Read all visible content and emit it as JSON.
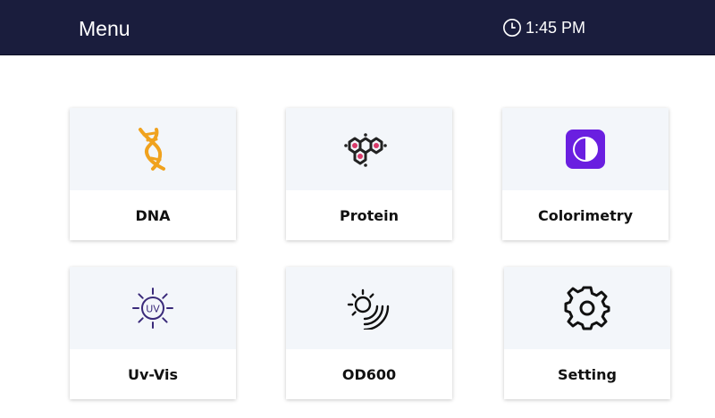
{
  "header": {
    "title": "Menu",
    "time": "1:45 PM",
    "clock_icon": "clock-icon"
  },
  "tiles": [
    {
      "label": "DNA",
      "icon": "dna-icon",
      "icon_color": "#f0a21e"
    },
    {
      "label": "Protein",
      "icon": "protein-icon",
      "icon_color": "#d93a6a"
    },
    {
      "label": "Colorimetry",
      "icon": "colorimetry-icon",
      "icon_color": "#6a1fe0"
    },
    {
      "label": "Uv-Vis",
      "icon": "uv-icon",
      "icon_color": "#3a2a7a"
    },
    {
      "label": "OD600",
      "icon": "od600-icon",
      "icon_color": "#111111"
    },
    {
      "label": "Setting",
      "icon": "gear-icon",
      "icon_color": "#111111"
    }
  ],
  "colors": {
    "header_bg": "#1a1d3d",
    "tile_top_bg": "#f3f6fa"
  }
}
